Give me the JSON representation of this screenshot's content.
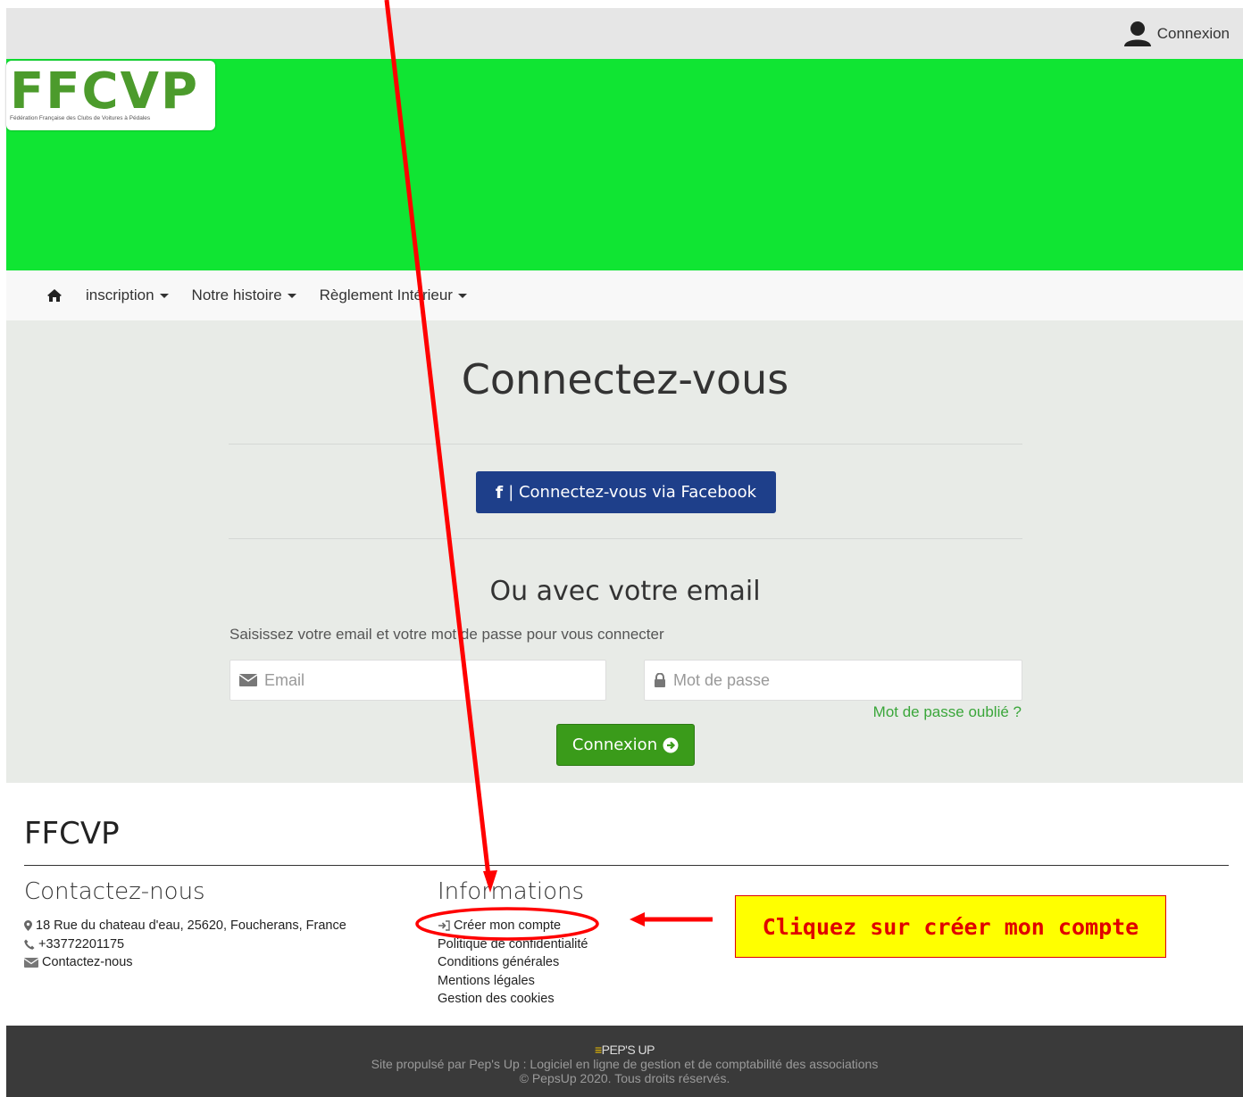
{
  "topbar": {
    "login_label": "Connexion",
    "user_icon": "user-icon"
  },
  "logo": {
    "title": "FFCVP",
    "subtitle": "Fédération Française des Clubs de Voitures à Pédales"
  },
  "nav": {
    "home_icon": "home-icon",
    "items": [
      {
        "label": "inscription"
      },
      {
        "label": "Notre histoire"
      },
      {
        "label": "Règlement Intérieur"
      }
    ]
  },
  "main": {
    "title": "Connectez-vous",
    "facebook_button": "| Connectez-vous via Facebook",
    "facebook_icon": "f",
    "subtitle": "Ou avec votre email",
    "instructions": "Saisissez votre email et votre mot de passe pour vous connecter",
    "email_placeholder": "Email",
    "password_placeholder": "Mot de passe",
    "forgot_link": "Mot de passe oublié ?",
    "login_button": "Connexion"
  },
  "footer": {
    "title": "FFCVP",
    "contact_heading": "Contactez-nous",
    "address": "18 Rue du chateau d'eau, 25620, Foucherans, France",
    "phone": "+33772201175",
    "contact_link": "Contactez-nous",
    "info_heading": "Informations",
    "info_links": [
      "Créer mon compte",
      "Politique de confidentialité",
      "Conditions générales",
      "Mentions légales",
      "Gestion des cookies"
    ]
  },
  "bottom": {
    "brand": "PEP'S UP",
    "line1": "Site propulsé par Pep's Up : Logiciel en ligne de gestion et de comptabilité des associations",
    "line2": "© PepsUp 2020. Tous droits réservés."
  },
  "annotation": {
    "callout_text": "Cliquez sur créer mon compte",
    "color": "#ff0000"
  }
}
